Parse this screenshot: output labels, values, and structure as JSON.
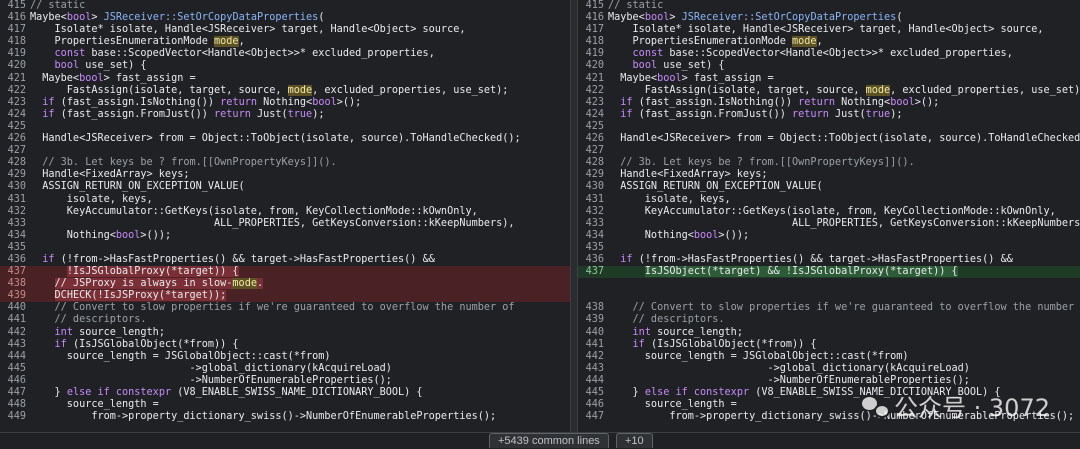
{
  "left": [
    {
      "n": "415",
      "t": "del0",
      "segs": [
        [
          "cm",
          "// static"
        ]
      ]
    },
    {
      "n": "416",
      "t": "",
      "segs": [
        [
          "",
          "Maybe<"
        ],
        [
          "kw",
          "bool"
        ],
        [
          "",
          "> "
        ],
        [
          "fn",
          "JSReceiver::SetOrCopyDataProperties"
        ],
        [
          "",
          "("
        ]
      ]
    },
    {
      "n": "417",
      "t": "",
      "segs": [
        [
          "",
          "    Isolate* isolate, Handle<JSReceiver> target, Handle<Object> source,"
        ]
      ]
    },
    {
      "n": "418",
      "t": "",
      "segs": [
        [
          "",
          "    PropertiesEnumerationMode "
        ],
        [
          "hl",
          "mode"
        ],
        [
          "",
          ","
        ]
      ]
    },
    {
      "n": "419",
      "t": "",
      "segs": [
        [
          "",
          "    "
        ],
        [
          "kw",
          "const"
        ],
        [
          "",
          " base::ScopedVector<Handle<Object>>* excluded_properties,"
        ]
      ]
    },
    {
      "n": "420",
      "t": "",
      "segs": [
        [
          "",
          "    "
        ],
        [
          "kw",
          "bool"
        ],
        [
          "",
          " use_set) {"
        ]
      ]
    },
    {
      "n": "421",
      "t": "",
      "segs": [
        [
          "",
          "  Maybe<"
        ],
        [
          "kw",
          "bool"
        ],
        [
          "",
          "> fast_assign ="
        ]
      ]
    },
    {
      "n": "422",
      "t": "",
      "segs": [
        [
          "",
          "      FastAssign(isolate, target, source, "
        ],
        [
          "hl",
          "mode"
        ],
        [
          "",
          ", excluded_properties, use_set);"
        ]
      ]
    },
    {
      "n": "423",
      "t": "",
      "segs": [
        [
          "",
          "  "
        ],
        [
          "kw",
          "if"
        ],
        [
          "",
          " (fast_assign.IsNothing()) "
        ],
        [
          "kw",
          "return"
        ],
        [
          "",
          " Nothing<"
        ],
        [
          "kw",
          "bool"
        ],
        [
          "",
          ">();"
        ]
      ]
    },
    {
      "n": "424",
      "t": "",
      "segs": [
        [
          "",
          "  "
        ],
        [
          "kw",
          "if"
        ],
        [
          "",
          " (fast_assign.FromJust()) "
        ],
        [
          "kw",
          "return"
        ],
        [
          "",
          " Just("
        ],
        [
          "kw",
          "true"
        ],
        [
          "",
          ");"
        ]
      ]
    },
    {
      "n": "425",
      "t": "",
      "segs": [
        [
          "",
          ""
        ]
      ]
    },
    {
      "n": "426",
      "t": "",
      "segs": [
        [
          "",
          "  Handle<JSReceiver> from = Object::ToObject(isolate, source).ToHandleChecked();"
        ]
      ]
    },
    {
      "n": "427",
      "t": "",
      "segs": [
        [
          "",
          ""
        ]
      ]
    },
    {
      "n": "428",
      "t": "",
      "segs": [
        [
          "cm",
          "  // 3b. Let keys be ? from.[[OwnPropertyKeys]]()."
        ]
      ]
    },
    {
      "n": "429",
      "t": "",
      "segs": [
        [
          "",
          "  Handle<FixedArray> keys;"
        ]
      ]
    },
    {
      "n": "430",
      "t": "",
      "segs": [
        [
          "",
          "  ASSIGN_RETURN_ON_EXCEPTION_VALUE("
        ]
      ]
    },
    {
      "n": "431",
      "t": "",
      "segs": [
        [
          "",
          "      isolate, keys,"
        ]
      ]
    },
    {
      "n": "432",
      "t": "",
      "segs": [
        [
          "",
          "      KeyAccumulator::GetKeys(isolate, from, KeyCollectionMode::kOwnOnly,"
        ]
      ]
    },
    {
      "n": "433",
      "t": "",
      "segs": [
        [
          "",
          "                              ALL_PROPERTIES, GetKeysConversion::kKeepNumbers),"
        ]
      ]
    },
    {
      "n": "434",
      "t": "",
      "segs": [
        [
          "",
          "      Nothing<"
        ],
        [
          "kw",
          "bool"
        ],
        [
          "",
          ">());"
        ]
      ]
    },
    {
      "n": "435",
      "t": "",
      "segs": [
        [
          "",
          ""
        ]
      ]
    },
    {
      "n": "436",
      "t": "",
      "segs": [
        [
          "",
          "  "
        ],
        [
          "kw",
          "if"
        ],
        [
          "",
          " (!from->HasFastProperties() && target->HasFastProperties() &&"
        ]
      ]
    },
    {
      "n": "437",
      "t": "del",
      "segs": [
        [
          "",
          "      "
        ],
        [
          "hld",
          "!IsJSGlobalProxy(*target)) {"
        ]
      ]
    },
    {
      "n": "438",
      "t": "del",
      "segs": [
        [
          "",
          "    "
        ],
        [
          "hld",
          "// JSProxy is always in slow-"
        ],
        [
          "hl",
          "mode"
        ],
        [
          "hld",
          "."
        ]
      ]
    },
    {
      "n": "439",
      "t": "del",
      "segs": [
        [
          "",
          "    "
        ],
        [
          "hld",
          "DCHECK(!IsJSProxy(*target));"
        ]
      ]
    },
    {
      "n": "440",
      "t": "",
      "segs": [
        [
          "cm",
          "    // Convert to slow properties if we're guaranteed to overflow the number of"
        ]
      ]
    },
    {
      "n": "441",
      "t": "",
      "segs": [
        [
          "cm",
          "    // descriptors."
        ]
      ]
    },
    {
      "n": "442",
      "t": "",
      "segs": [
        [
          "",
          "    "
        ],
        [
          "kw",
          "int"
        ],
        [
          "",
          " source_length;"
        ]
      ]
    },
    {
      "n": "443",
      "t": "",
      "segs": [
        [
          "",
          "    "
        ],
        [
          "kw",
          "if"
        ],
        [
          "",
          " (IsJSGlobalObject(*from)) {"
        ]
      ]
    },
    {
      "n": "444",
      "t": "",
      "segs": [
        [
          "",
          "      source_length = JSGlobalObject::cast(*from)"
        ]
      ]
    },
    {
      "n": "445",
      "t": "",
      "segs": [
        [
          "",
          "                          ->global_dictionary(kAcquireLoad)"
        ]
      ]
    },
    {
      "n": "446",
      "t": "",
      "segs": [
        [
          "",
          "                          ->NumberOfEnumerableProperties();"
        ]
      ]
    },
    {
      "n": "447",
      "t": "",
      "segs": [
        [
          "",
          "    } "
        ],
        [
          "kw",
          "else if constexpr"
        ],
        [
          "",
          " (V8_ENABLE_SWISS_NAME_DICTIONARY_BOOL) {"
        ]
      ]
    },
    {
      "n": "448",
      "t": "",
      "segs": [
        [
          "",
          "      source_length ="
        ]
      ]
    },
    {
      "n": "449",
      "t": "",
      "segs": [
        [
          "",
          "          from->property_dictionary_swiss()->NumberOfEnumerableProperties();"
        ]
      ]
    }
  ],
  "right": [
    {
      "n": "415",
      "t": "",
      "segs": [
        [
          "cm",
          "// static"
        ]
      ]
    },
    {
      "n": "416",
      "t": "",
      "segs": [
        [
          "",
          "Maybe<"
        ],
        [
          "kw",
          "bool"
        ],
        [
          "",
          "> "
        ],
        [
          "fn",
          "JSReceiver::SetOrCopyDataProperties"
        ],
        [
          "",
          "("
        ]
      ]
    },
    {
      "n": "417",
      "t": "",
      "segs": [
        [
          "",
          "    Isolate* isolate, Handle<JSReceiver> target, Handle<Object> source,"
        ]
      ]
    },
    {
      "n": "418",
      "t": "",
      "segs": [
        [
          "",
          "    PropertiesEnumerationMode "
        ],
        [
          "hl",
          "mode"
        ],
        [
          "",
          ","
        ]
      ]
    },
    {
      "n": "419",
      "t": "",
      "segs": [
        [
          "",
          "    "
        ],
        [
          "kw",
          "const"
        ],
        [
          "",
          " base::ScopedVector<Handle<Object>>* excluded_properties,"
        ]
      ]
    },
    {
      "n": "420",
      "t": "",
      "segs": [
        [
          "",
          "    "
        ],
        [
          "kw",
          "bool"
        ],
        [
          "",
          " use_set) {"
        ]
      ]
    },
    {
      "n": "421",
      "t": "",
      "segs": [
        [
          "",
          "  Maybe<"
        ],
        [
          "kw",
          "bool"
        ],
        [
          "",
          "> fast_assign ="
        ]
      ]
    },
    {
      "n": "422",
      "t": "",
      "segs": [
        [
          "",
          "      FastAssign(isolate, target, source, "
        ],
        [
          "hl",
          "mode"
        ],
        [
          "",
          ", excluded_properties, use_set);"
        ]
      ]
    },
    {
      "n": "423",
      "t": "",
      "segs": [
        [
          "",
          "  "
        ],
        [
          "kw",
          "if"
        ],
        [
          "",
          " (fast_assign.IsNothing()) "
        ],
        [
          "kw",
          "return"
        ],
        [
          "",
          " Nothing<"
        ],
        [
          "kw",
          "bool"
        ],
        [
          "",
          ">();"
        ]
      ]
    },
    {
      "n": "424",
      "t": "",
      "segs": [
        [
          "",
          "  "
        ],
        [
          "kw",
          "if"
        ],
        [
          "",
          " (fast_assign.FromJust()) "
        ],
        [
          "kw",
          "return"
        ],
        [
          "",
          " Just("
        ],
        [
          "kw",
          "true"
        ],
        [
          "",
          ");"
        ]
      ]
    },
    {
      "n": "425",
      "t": "",
      "segs": [
        [
          "",
          ""
        ]
      ]
    },
    {
      "n": "426",
      "t": "",
      "segs": [
        [
          "",
          "  Handle<JSReceiver> from = Object::ToObject(isolate, source).ToHandleChecked();"
        ]
      ]
    },
    {
      "n": "427",
      "t": "",
      "segs": [
        [
          "",
          ""
        ]
      ]
    },
    {
      "n": "428",
      "t": "",
      "segs": [
        [
          "cm",
          "  // 3b. Let keys be ? from.[[OwnPropertyKeys]]()."
        ]
      ]
    },
    {
      "n": "429",
      "t": "",
      "segs": [
        [
          "",
          "  Handle<FixedArray> keys;"
        ]
      ]
    },
    {
      "n": "430",
      "t": "",
      "segs": [
        [
          "",
          "  ASSIGN_RETURN_ON_EXCEPTION_VALUE("
        ]
      ]
    },
    {
      "n": "431",
      "t": "",
      "segs": [
        [
          "",
          "      isolate, keys,"
        ]
      ]
    },
    {
      "n": "432",
      "t": "",
      "segs": [
        [
          "",
          "      KeyAccumulator::GetKeys(isolate, from, KeyCollectionMode::kOwnOnly,"
        ]
      ]
    },
    {
      "n": "433",
      "t": "",
      "segs": [
        [
          "",
          "                              ALL_PROPERTIES, GetKeysConversion::kKeepNumbers),"
        ]
      ]
    },
    {
      "n": "434",
      "t": "",
      "segs": [
        [
          "",
          "      Nothing<"
        ],
        [
          "kw",
          "bool"
        ],
        [
          "",
          ">());"
        ]
      ]
    },
    {
      "n": "435",
      "t": "",
      "segs": [
        [
          "",
          ""
        ]
      ]
    },
    {
      "n": "436",
      "t": "",
      "segs": [
        [
          "",
          "  "
        ],
        [
          "kw",
          "if"
        ],
        [
          "",
          " (!from->HasFastProperties() && target->HasFastProperties() &&"
        ]
      ]
    },
    {
      "n": "437",
      "t": "add",
      "segs": [
        [
          "",
          "      "
        ],
        [
          "hla",
          "IsJSObject(*target) && !IsJSGlobalProxy(*target)) {"
        ]
      ]
    },
    {
      "n": "",
      "t": "empty",
      "segs": [
        [
          "",
          ""
        ]
      ]
    },
    {
      "n": "",
      "t": "empty",
      "segs": [
        [
          "",
          ""
        ]
      ]
    },
    {
      "n": "438",
      "t": "",
      "segs": [
        [
          "cm",
          "    // Convert to slow properties if we're guaranteed to overflow the number of"
        ]
      ]
    },
    {
      "n": "439",
      "t": "",
      "segs": [
        [
          "cm",
          "    // descriptors."
        ]
      ]
    },
    {
      "n": "440",
      "t": "",
      "segs": [
        [
          "",
          "    "
        ],
        [
          "kw",
          "int"
        ],
        [
          "",
          " source_length;"
        ]
      ]
    },
    {
      "n": "441",
      "t": "",
      "segs": [
        [
          "",
          "    "
        ],
        [
          "kw",
          "if"
        ],
        [
          "",
          " (IsJSGlobalObject(*from)) {"
        ]
      ]
    },
    {
      "n": "442",
      "t": "",
      "segs": [
        [
          "",
          "      source_length = JSGlobalObject::cast(*from)"
        ]
      ]
    },
    {
      "n": "443",
      "t": "",
      "segs": [
        [
          "",
          "                          ->global_dictionary(kAcquireLoad)"
        ]
      ]
    },
    {
      "n": "444",
      "t": "",
      "segs": [
        [
          "",
          "                          ->NumberOfEnumerableProperties();"
        ]
      ]
    },
    {
      "n": "445",
      "t": "",
      "segs": [
        [
          "",
          "    } "
        ],
        [
          "kw",
          "else if constexpr"
        ],
        [
          "",
          " (V8_ENABLE_SWISS_NAME_DICTIONARY_BOOL) {"
        ]
      ]
    },
    {
      "n": "446",
      "t": "",
      "segs": [
        [
          "",
          "      source_length ="
        ]
      ]
    },
    {
      "n": "447",
      "t": "",
      "segs": [
        [
          "",
          "          from->property_dictionary_swiss()->NumberOfEnumerableProperties();"
        ]
      ]
    }
  ],
  "bottom": {
    "expand_common": "+5439 common lines",
    "expand_ten": "+10"
  },
  "watermark": {
    "text": "公众号 · 3072",
    "icon": "wechat-icon"
  },
  "colors": {
    "background": "#202124",
    "deleted_line": "#4a2226",
    "added_line": "#1f3a27",
    "keyword": "#c58af9",
    "function": "#8ab4f8",
    "match_highlight": "#5c5226"
  }
}
